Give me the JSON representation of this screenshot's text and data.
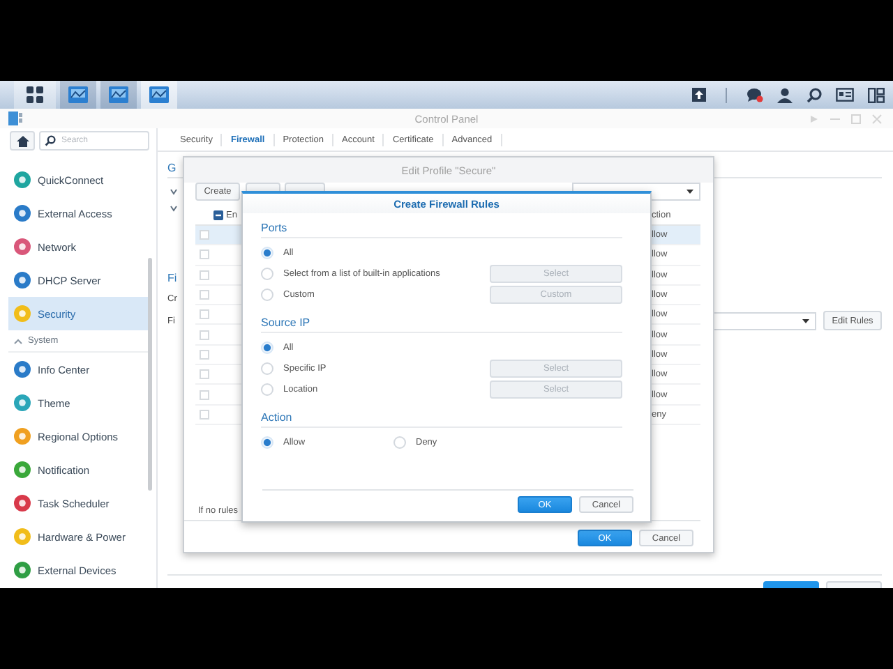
{
  "taskbar": {
    "apps": [
      {
        "selected": false
      },
      {
        "selected": false
      },
      {
        "selected": true
      }
    ]
  },
  "window": {
    "title": "Control Panel"
  },
  "sidebar": {
    "search": {
      "placeholder": "Search"
    },
    "items": [
      {
        "kind": "item",
        "label": "QuickConnect",
        "selected": false
      },
      {
        "kind": "item",
        "label": "External Access",
        "selected": false
      },
      {
        "kind": "item",
        "label": "Network",
        "selected": false
      },
      {
        "kind": "item",
        "label": "DHCP Server",
        "selected": false
      },
      {
        "kind": "item",
        "label": "Security",
        "selected": true
      },
      {
        "kind": "header",
        "label": "System",
        "expanded": true
      },
      {
        "kind": "item",
        "label": "Info Center",
        "selected": false
      },
      {
        "kind": "item",
        "label": "Theme",
        "selected": false
      },
      {
        "kind": "item",
        "label": "Regional Options",
        "selected": false
      },
      {
        "kind": "item",
        "label": "Notification",
        "selected": false
      },
      {
        "kind": "item",
        "label": "Task Scheduler",
        "selected": false
      },
      {
        "kind": "item",
        "label": "Hardware & Power",
        "selected": false
      },
      {
        "kind": "item",
        "label": "External Devices",
        "selected": false
      }
    ]
  },
  "tabs": [
    {
      "label": "Security",
      "selected": false
    },
    {
      "label": "Firewall",
      "selected": true
    },
    {
      "label": "Protection",
      "selected": false
    },
    {
      "label": "Account",
      "selected": false
    },
    {
      "label": "Certificate",
      "selected": false
    },
    {
      "label": "Advanced",
      "selected": false
    }
  ],
  "firewall_page": {
    "heading": "G",
    "section_heading": "Fi",
    "row_labels": [
      "Cr",
      "Fi"
    ],
    "edit_rules_button": "Edit Rules"
  },
  "edit_profile_dialog": {
    "title": "Edit Profile \"Secure\"",
    "create_button": "Create",
    "table": {
      "columns": [
        "En",
        "ction"
      ],
      "rows": [
        {
          "selected": true,
          "column_2": "llow"
        },
        {
          "selected": false,
          "column_2": "llow"
        },
        {
          "selected": false,
          "column_2": "llow"
        },
        {
          "selected": false,
          "column_2": "llow"
        },
        {
          "selected": false,
          "column_2": "llow"
        },
        {
          "selected": false,
          "column_2": "llow"
        },
        {
          "selected": false,
          "column_2": "llow"
        },
        {
          "selected": false,
          "column_2": "llow"
        },
        {
          "selected": false,
          "column_2": "llow"
        },
        {
          "selected": false,
          "column_2": "eny"
        }
      ]
    },
    "note": "If no rules",
    "buttons": [
      {
        "label": "OK",
        "kind": "primary"
      },
      {
        "label": "Cancel",
        "kind": "secondary"
      }
    ]
  },
  "create_rules_dialog": {
    "title": "Create Firewall Rules",
    "sections": [
      {
        "heading": "Ports",
        "kind": "list",
        "options": [
          {
            "label": "All",
            "selected": true
          },
          {
            "label": "Select from a list of built-in applications",
            "selected": false,
            "button": {
              "label": "Select",
              "disabled": true
            }
          },
          {
            "label": "Custom",
            "selected": false,
            "button": {
              "label": "Custom",
              "disabled": true
            }
          }
        ]
      },
      {
        "heading": "Source IP",
        "kind": "list",
        "options": [
          {
            "label": "All",
            "selected": true
          },
          {
            "label": "Specific IP",
            "selected": false,
            "button": {
              "label": "Select",
              "disabled": true
            }
          },
          {
            "label": "Location",
            "selected": false,
            "button": {
              "label": "Select",
              "disabled": true
            }
          }
        ]
      },
      {
        "heading": "Action",
        "kind": "inline",
        "options": [
          {
            "label": "Allow",
            "selected": true
          },
          {
            "label": "Deny",
            "selected": false
          }
        ]
      }
    ],
    "buttons": [
      {
        "label": "OK",
        "kind": "primary"
      },
      {
        "label": "Cancel",
        "kind": "secondary"
      }
    ]
  }
}
